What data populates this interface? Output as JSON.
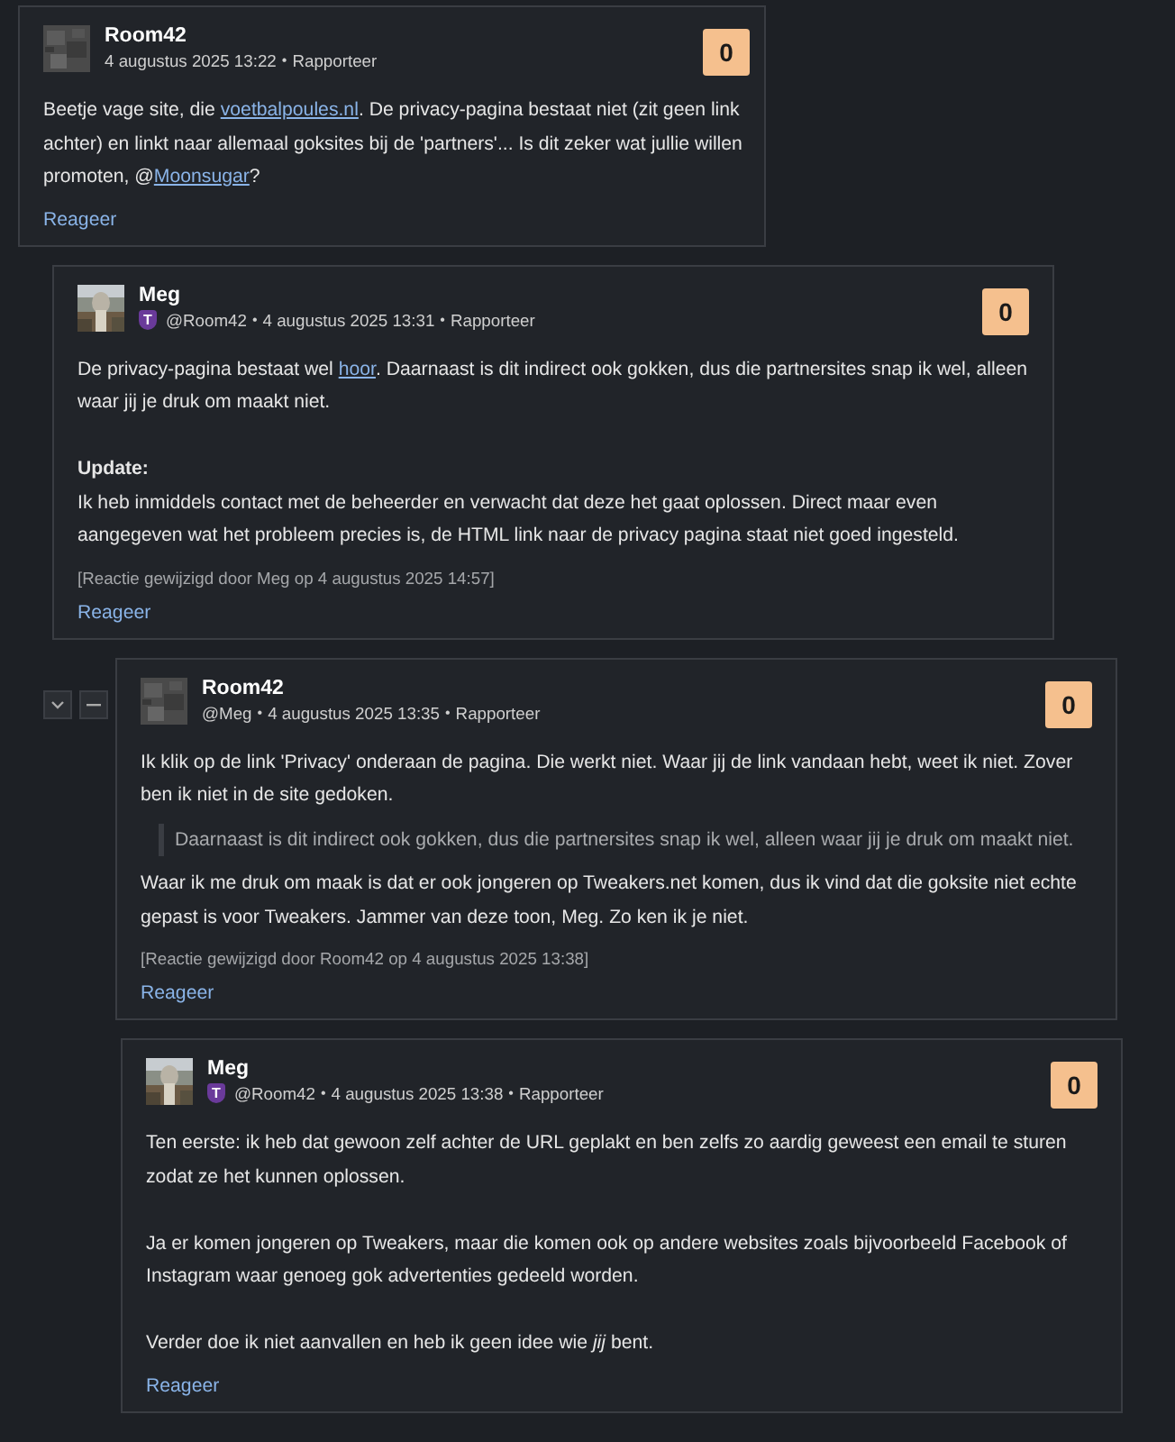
{
  "comments": [
    {
      "author": "Room42",
      "meta": [
        {
          "kind": "date",
          "text": "4 augustus 2025 13:22"
        },
        {
          "kind": "sep",
          "text": "•"
        },
        {
          "kind": "link",
          "text": "Rapporteer"
        }
      ],
      "score": "0",
      "thread_controls": false,
      "body": [
        {
          "kind": "paragraph",
          "parts": [
            {
              "kind": "text",
              "text": "Beetje vage site, die "
            },
            {
              "kind": "link",
              "text": "voetbalpoules.nl"
            },
            {
              "kind": "text",
              "text": ". De privacy-pagina bestaat niet (zit geen link achter) en linkt naar allemaal goksites bij de 'partners'... Is dit zeker wat jullie willen promoten, @"
            },
            {
              "kind": "link",
              "text": "Moonsugar"
            },
            {
              "kind": "text",
              "text": "?"
            }
          ]
        }
      ],
      "reply": "Reageer",
      "children": [
        {
          "author": "Meg",
          "badge": "T",
          "meta": [
            {
              "kind": "mention",
              "text": "@Room42"
            },
            {
              "kind": "sep",
              "text": "•"
            },
            {
              "kind": "date",
              "text": "4 augustus 2025 13:31"
            },
            {
              "kind": "sep",
              "text": "•"
            },
            {
              "kind": "link",
              "text": "Rapporteer"
            }
          ],
          "score": "0",
          "thread_controls": false,
          "body": [
            {
              "kind": "paragraph",
              "parts": [
                {
                  "kind": "text",
                  "text": "De privacy-pagina bestaat wel "
                },
                {
                  "kind": "link",
                  "text": "hoor"
                },
                {
                  "kind": "text",
                  "text": ". Daarnaast is dit indirect ook gokken, dus die partnersites snap ik wel, alleen waar jij je druk om maakt niet."
                }
              ]
            },
            {
              "kind": "heading",
              "text": "Update:"
            },
            {
              "kind": "paragraph",
              "parts": [
                {
                  "kind": "text",
                  "text": "Ik heb inmiddels contact met de beheerder en verwacht dat deze het gaat oplossen. Direct maar even aangegeven wat het probleem precies is, de HTML link naar de privacy pagina staat niet goed ingesteld."
                }
              ]
            }
          ],
          "edited": "[Reactie gewijzigd door Meg op 4 augustus 2025 14:57]",
          "reply": "Reageer",
          "children": [
            {
              "author": "Room42",
              "meta": [
                {
                  "kind": "mention",
                  "text": "@Meg"
                },
                {
                  "kind": "sep",
                  "text": "•"
                },
                {
                  "kind": "date",
                  "text": "4 augustus 2025 13:35"
                },
                {
                  "kind": "sep",
                  "text": "•"
                },
                {
                  "kind": "link",
                  "text": "Rapporteer"
                }
              ],
              "score": "0",
              "thread_controls": true,
              "body": [
                {
                  "kind": "paragraph",
                  "parts": [
                    {
                      "kind": "text",
                      "text": "Ik klik op de link 'Privacy' onderaan de pagina. Die werkt niet. Waar jij de link vandaan hebt, weet ik niet. Zover ben ik niet in de site gedoken."
                    }
                  ]
                },
                {
                  "kind": "quote",
                  "text": "Daarnaast is dit indirect ook gokken, dus die partnersites snap ik wel, alleen waar jij je druk om maakt niet."
                },
                {
                  "kind": "paragraph",
                  "parts": [
                    {
                      "kind": "text",
                      "text": "Waar ik me druk om maak is dat er ook jongeren op Tweakers.net komen, dus ik vind dat die goksite niet echte gepast is voor Tweakers. Jammer van deze toon, Meg. Zo ken ik je niet."
                    }
                  ]
                }
              ],
              "edited": "[Reactie gewijzigd door Room42 op 4 augustus 2025 13:38]",
              "reply": "Reageer",
              "children": [
                {
                  "author": "Meg",
                  "badge": "T",
                  "meta": [
                    {
                      "kind": "mention",
                      "text": "@Room42"
                    },
                    {
                      "kind": "sep",
                      "text": "•"
                    },
                    {
                      "kind": "date",
                      "text": "4 augustus 2025 13:38"
                    },
                    {
                      "kind": "sep",
                      "text": "•"
                    },
                    {
                      "kind": "link",
                      "text": "Rapporteer"
                    }
                  ],
                  "score": "0",
                  "thread_controls": false,
                  "body": [
                    {
                      "kind": "paragraph",
                      "parts": [
                        {
                          "kind": "text",
                          "text": "Ten eerste: ik heb dat gewoon zelf achter de URL geplakt en ben zelfs zo aardig geweest een email te sturen zodat ze het kunnen oplossen."
                        }
                      ]
                    },
                    {
                      "kind": "spacer"
                    },
                    {
                      "kind": "paragraph",
                      "parts": [
                        {
                          "kind": "text",
                          "text": "Ja er komen jongeren op Tweakers, maar die komen ook op andere websites zoals bijvoorbeeld Facebook of Instagram waar genoeg gok advertenties gedeeld worden."
                        }
                      ]
                    },
                    {
                      "kind": "spacer"
                    },
                    {
                      "kind": "paragraph",
                      "parts": [
                        {
                          "kind": "text",
                          "text": "Verder doe ik niet aanvallen en heb ik geen idee wie *jij* bent."
                        }
                      ]
                    }
                  ],
                  "reply": "Reageer"
                }
              ]
            }
          ]
        }
      ]
    }
  ]
}
